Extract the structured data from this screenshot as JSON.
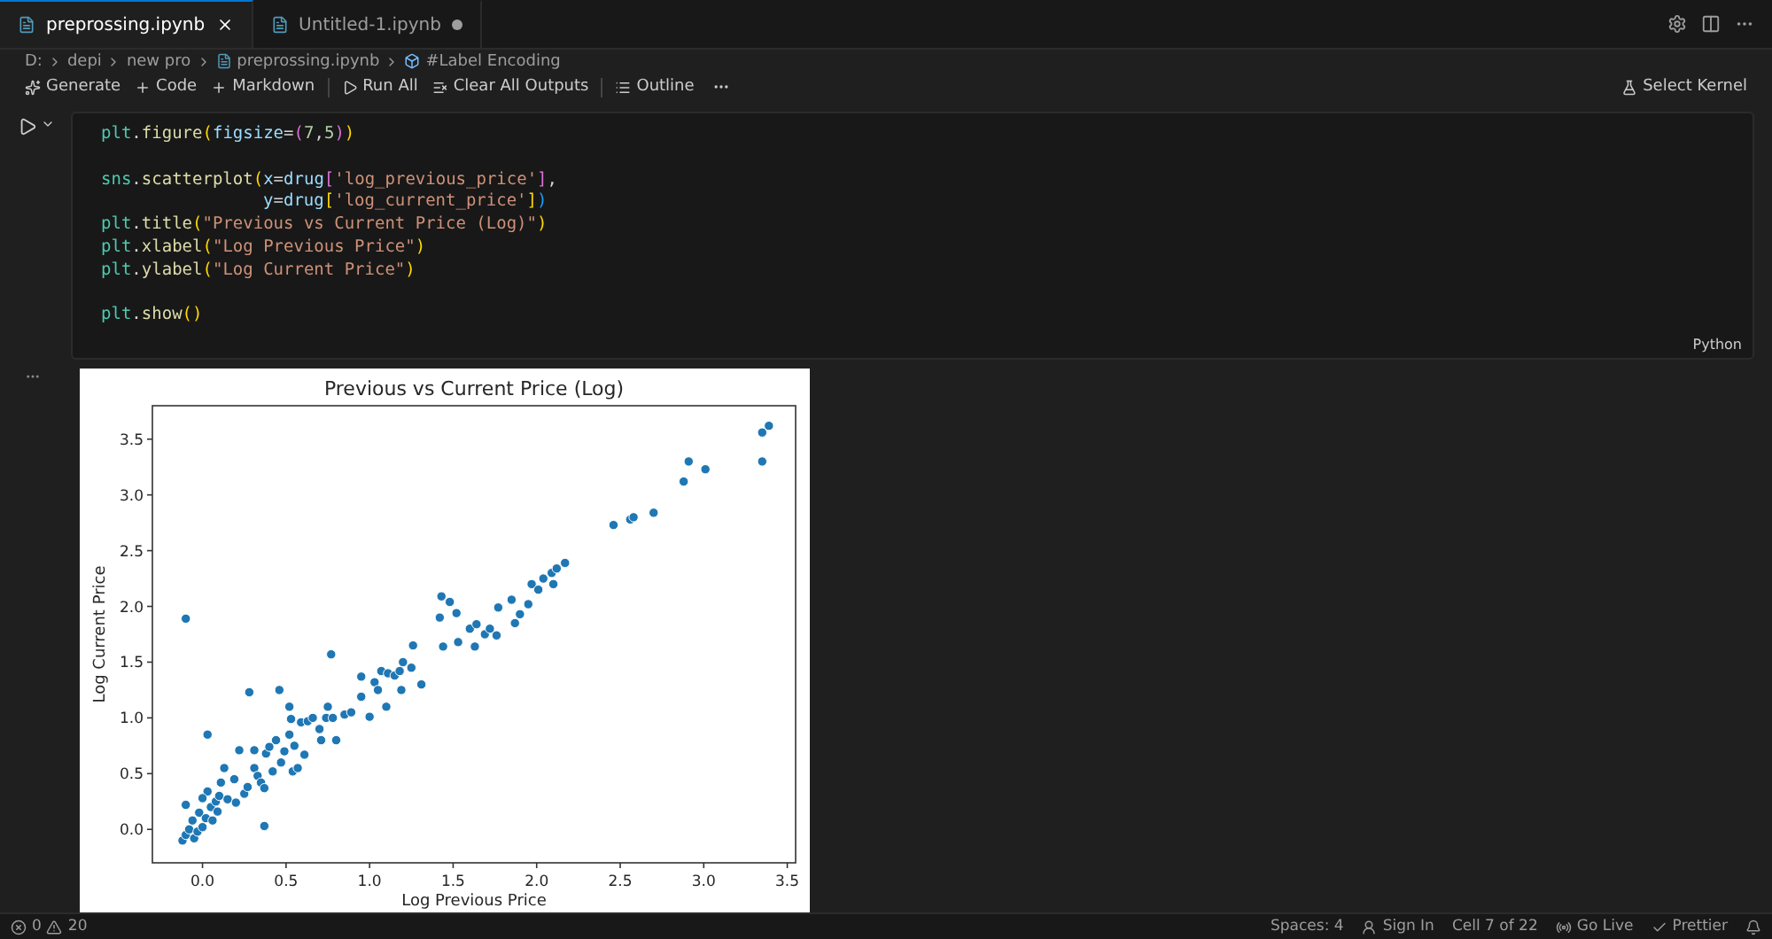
{
  "tabs": [
    {
      "label": "preprossing.ipynb",
      "selected": true,
      "modified": false
    },
    {
      "label": "Untitled-1.ipynb",
      "selected": false,
      "modified": true
    }
  ],
  "breadcrumb": [
    {
      "label": "D:",
      "kind": "folder"
    },
    {
      "label": "depi",
      "kind": "folder"
    },
    {
      "label": "new pro",
      "kind": "folder"
    },
    {
      "label": "preprossing.ipynb",
      "kind": "file"
    },
    {
      "label": "#Label Encoding",
      "kind": "section"
    }
  ],
  "toolbar": {
    "groups": [
      [
        {
          "label": "Generate",
          "kind": "sparkle"
        },
        {
          "label": "Code",
          "kind": "plus"
        },
        {
          "label": "Markdown",
          "kind": "plus"
        }
      ],
      [
        {
          "label": "Run All",
          "kind": "run"
        },
        {
          "label": "Clear All Outputs",
          "kind": "clear"
        }
      ],
      [
        {
          "label": "Outline",
          "kind": "outline"
        }
      ]
    ],
    "kernel": "Select Kernel"
  },
  "cell": {
    "code": "plt.figure(figsize=(7,5))\n\nsns.scatterplot(x=drug['log_previous_price'],\n                y=drug['log_current_price'])\nplt.title(\"Previous vs Current Price (Log)\")\nplt.xlabel(\"Log Previous Price\")\nplt.ylabel(\"Log Current Price\")\n\nplt.show()",
    "language": "Python"
  },
  "output": {
    "chart_data": {
      "type": "scatter",
      "title": "Previous vs Current Price (Log)",
      "xlabel": "Log Previous Price",
      "ylabel": "Log Current Price",
      "xlim": [
        -0.3,
        3.55
      ],
      "ylim": [
        -0.3,
        3.8
      ],
      "xticks": [
        {
          "value": 0,
          "label": "0.0"
        },
        {
          "value": 0.5,
          "label": "0.5"
        },
        {
          "value": 1,
          "label": "1.0"
        },
        {
          "value": 1.5,
          "label": "1.5"
        },
        {
          "value": 2,
          "label": "2.0"
        },
        {
          "value": 2.5,
          "label": "2.5"
        },
        {
          "value": 3,
          "label": "3.0"
        },
        {
          "value": 3.5,
          "label": "3.5"
        }
      ],
      "yticks": [
        {
          "value": 0,
          "label": "0.0"
        },
        {
          "value": 0.5,
          "label": "0.5"
        },
        {
          "value": 1,
          "label": "1.0"
        },
        {
          "value": 1.5,
          "label": "1.5"
        },
        {
          "value": 2,
          "label": "2.0"
        },
        {
          "value": 2.5,
          "label": "2.5"
        },
        {
          "value": 3,
          "label": "3.0"
        },
        {
          "value": 3.5,
          "label": "3.5"
        }
      ],
      "x": [
        -0.1,
        0.03,
        0.28,
        0.46,
        0.37,
        0.77,
        -0.1,
        -0.12,
        -0.1,
        -0.08,
        -0.06,
        -0.05,
        -0.03,
        -0.02,
        0.0,
        0.02,
        0.03,
        0.0,
        0.05,
        0.06,
        0.08,
        0.09,
        0.1,
        0.11,
        0.13,
        0.15,
        0.19,
        0.2,
        0.22,
        0.25,
        0.27,
        0.31,
        0.31,
        0.33,
        0.35,
        0.37,
        0.38,
        0.4,
        0.42,
        0.44,
        0.47,
        0.49,
        0.52,
        0.52,
        0.53,
        0.54,
        0.55,
        0.57,
        0.59,
        0.61,
        0.63,
        0.66,
        0.7,
        0.71,
        0.74,
        0.75,
        0.78,
        0.8,
        0.85,
        0.89,
        0.95,
        0.95,
        1.0,
        1.03,
        1.05,
        1.07,
        1.1,
        1.11,
        1.15,
        1.18,
        1.19,
        1.2,
        1.25,
        1.26,
        1.31,
        1.42,
        1.43,
        1.44,
        1.48,
        1.52,
        1.53,
        1.6,
        1.63,
        1.64,
        1.69,
        1.72,
        1.76,
        1.77,
        1.85,
        1.87,
        1.9,
        1.95,
        1.97,
        2.01,
        2.04,
        2.09,
        2.1,
        2.12,
        2.17,
        2.46,
        2.56,
        2.58,
        2.7,
        2.88,
        2.91,
        3.01,
        3.35,
        3.35,
        3.39
      ],
      "series": [
        {
          "color": "#1f77b4",
          "values": [
            1.89,
            0.85,
            1.23,
            1.25,
            0.03,
            1.57,
            0.22,
            -0.1,
            -0.05,
            0.0,
            0.08,
            -0.08,
            -0.02,
            0.15,
            0.02,
            0.1,
            0.34,
            0.28,
            0.2,
            0.08,
            0.25,
            0.16,
            0.3,
            0.42,
            0.55,
            0.27,
            0.45,
            0.24,
            0.71,
            0.32,
            0.38,
            0.71,
            0.55,
            0.48,
            0.42,
            0.37,
            0.68,
            0.74,
            0.52,
            0.8,
            0.6,
            0.7,
            0.85,
            1.1,
            0.99,
            0.52,
            0.75,
            0.55,
            0.96,
            0.67,
            0.97,
            1.0,
            0.9,
            0.8,
            1.0,
            1.1,
            1.0,
            0.8,
            1.03,
            1.05,
            1.19,
            1.37,
            1.01,
            1.32,
            1.25,
            1.42,
            1.1,
            1.4,
            1.38,
            1.42,
            1.25,
            1.5,
            1.45,
            1.65,
            1.3,
            1.9,
            2.09,
            1.64,
            2.04,
            1.94,
            1.68,
            1.8,
            1.64,
            1.84,
            1.75,
            1.8,
            1.74,
            1.99,
            2.06,
            1.85,
            1.93,
            2.02,
            2.2,
            2.15,
            2.25,
            2.3,
            2.2,
            2.34,
            2.39,
            2.73,
            2.78,
            2.8,
            2.84,
            3.12,
            3.3,
            3.23,
            3.3,
            3.56,
            3.62
          ]
        }
      ]
    }
  },
  "status_bar": {
    "errors": "0",
    "warnings": "20",
    "items": [
      {
        "label": "Spaces: 4",
        "kind": "text"
      },
      {
        "label": "Sign In",
        "kind": "account"
      },
      {
        "label": "Cell 7 of 22",
        "kind": "text"
      },
      {
        "label": "Go Live",
        "kind": "broadcast"
      },
      {
        "label": "Prettier",
        "kind": "check"
      }
    ]
  }
}
